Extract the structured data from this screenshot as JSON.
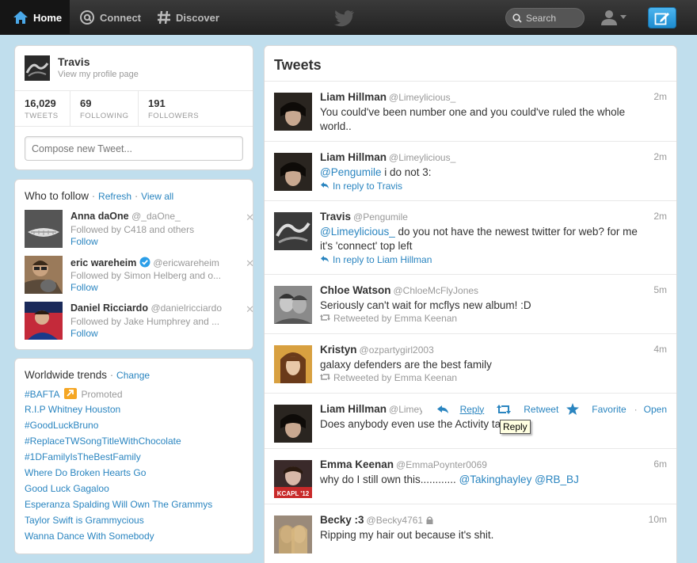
{
  "topbar": {
    "home": "Home",
    "connect": "Connect",
    "discover": "Discover",
    "search_placeholder": "Search"
  },
  "profile": {
    "name": "Travis",
    "link": "View my profile page",
    "stats": [
      {
        "num": "16,029",
        "label": "TWEETS"
      },
      {
        "num": "69",
        "label": "FOLLOWING"
      },
      {
        "num": "191",
        "label": "FOLLOWERS"
      }
    ],
    "compose_placeholder": "Compose new Tweet..."
  },
  "who_to_follow": {
    "title": "Who to follow",
    "refresh": "Refresh",
    "view_all": "View all",
    "items": [
      {
        "name": "Anna daOne",
        "screen": "@_daOne_",
        "followed_by": "Followed by C418 and others",
        "follow": "Follow",
        "close": "✕"
      },
      {
        "name": "eric wareheim",
        "screen": "@ericwareheim",
        "followed_by": "Followed by Simon Helberg and o...",
        "follow": "Follow",
        "close": "✕"
      },
      {
        "name": "Daniel Ricciardo",
        "screen": "@danielricciardo",
        "followed_by": "Followed by Jake Humphrey and ...",
        "follow": "Follow",
        "close": "✕"
      }
    ]
  },
  "trends": {
    "title": "Worldwide trends",
    "change": "Change",
    "promoted": "Promoted",
    "items": [
      "#BAFTA",
      "R.I.P Whitney Houston",
      "#GoodLuckBruno",
      "#ReplaceTWSongTitleWithChocolate",
      "#1DFamilyIsTheBestFamily",
      "Where Do Broken Hearts Go",
      "Good Luck Gagaloo",
      "Esperanza Spalding Will Own The Grammys",
      "Taylor Swift is Grammycious",
      "Wanna Dance With Somebody"
    ]
  },
  "timeline": {
    "title": "Tweets",
    "tweets": [
      {
        "name": "Liam Hillman",
        "screen": "@Limeylicious_",
        "time": "2m",
        "text": "You could've been number one and you could've ruled the whole world.."
      },
      {
        "name": "Liam Hillman",
        "screen": "@Limeylicious_",
        "time": "2m",
        "mention": "@Pengumile",
        "text": " i do not 3:",
        "context": "In reply to Travis"
      },
      {
        "name": "Travis",
        "screen": "@Pengumile",
        "time": "2m",
        "mention": "@Limeylicious_",
        "text": " do you not have the newest twitter for web? for me it's 'connect' top left",
        "context": "In reply to Liam Hillman"
      },
      {
        "name": "Chloe Watson",
        "screen": "@ChloeMcFlyJones",
        "time": "5m",
        "text": "Seriously can't wait for mcflys new album! :D",
        "context": "Retweeted by Emma Keenan"
      },
      {
        "name": "Kristyn",
        "screen": "@ozpartygirl2003",
        "time": "4m",
        "text": "galaxy defenders are the best family",
        "context": "Retweeted by Emma Keenan"
      },
      {
        "name": "Liam Hillman",
        "screen": "@Limeylicious_",
        "time": "",
        "text": "Does anybody even use the Activity tab?"
      },
      {
        "name": "Emma Keenan",
        "screen": "@EmmaPoynter0069",
        "time": "6m",
        "text": "why do I still own this............ ",
        "mention": "@Takinghayley",
        "mention2": "@RB_BJ"
      },
      {
        "name": "Becky :3",
        "screen": "@Becky4761",
        "time": "10m",
        "text": "Ripping my hair out because it's shit."
      }
    ],
    "actions": {
      "reply": "Reply",
      "retweet": "Retweet",
      "favorite": "Favorite",
      "open": "Open"
    },
    "tooltip": "Reply"
  }
}
